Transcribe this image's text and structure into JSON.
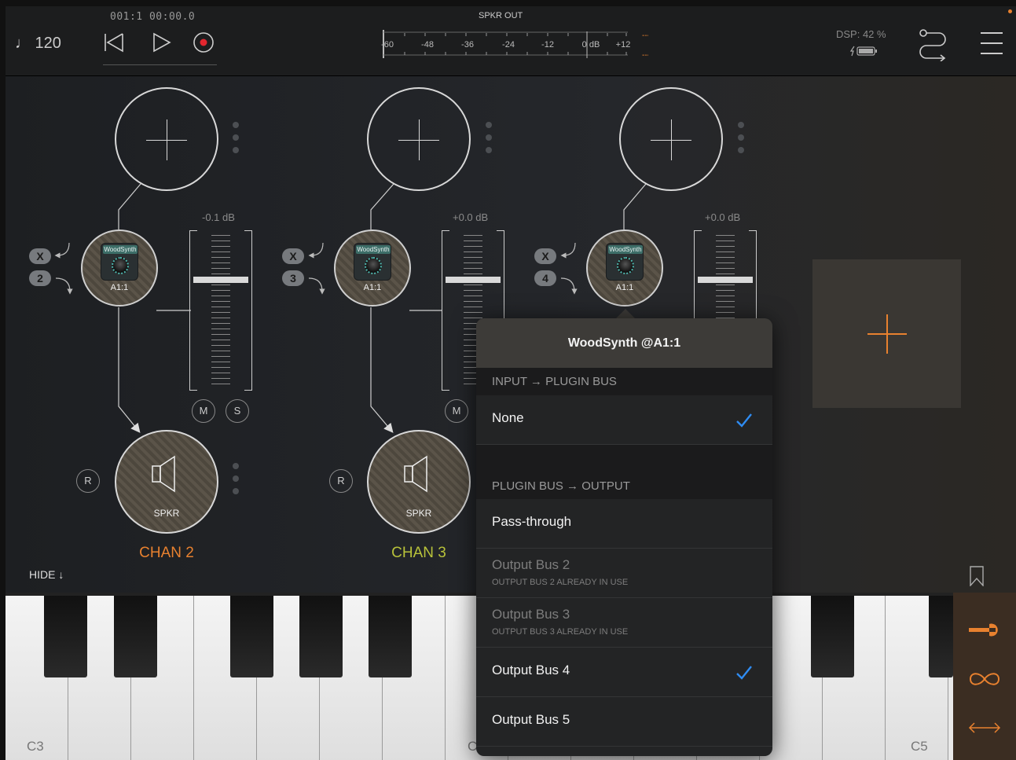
{
  "transport": {
    "tempo": "♩ 120",
    "position": "001:1  00:00.0"
  },
  "meter": {
    "title": "SPKR OUT",
    "scale": [
      "-60",
      "-48",
      "-36",
      "-24",
      "-12",
      "0 dB",
      "+12"
    ],
    "peak_top": "---",
    "peak_bottom": "---"
  },
  "status": {
    "dsp": "DSP: 42 %"
  },
  "channels": [
    {
      "label": "CHAN 2",
      "color": "#e8812f",
      "bus_in": "X",
      "bus_out": "2",
      "plugin_name": "WoodSynth",
      "plugin_slot": "A1:1",
      "gain": "-0.1 dB",
      "gain_position": 0.31,
      "speaker": "SPKR",
      "mute": "M",
      "solo": "S",
      "record": "R"
    },
    {
      "label": "CHAN 3",
      "color": "#b8c23a",
      "bus_in": "X",
      "bus_out": "3",
      "plugin_name": "WoodSynth",
      "plugin_slot": "A1:1",
      "gain": "+0.0 dB",
      "gain_position": 0.31,
      "speaker": "SPKR",
      "mute": "M",
      "record": "R"
    },
    {
      "bus_in": "X",
      "bus_out": "4",
      "plugin_name": "WoodSynth",
      "plugin_slot": "A1:1",
      "gain": "+0.0 dB",
      "gain_position": 0.31
    }
  ],
  "hide_button": "HIDE ↓",
  "keyboard": {
    "labels": [
      "C3",
      "C",
      "C5"
    ]
  },
  "popover": {
    "title": "WoodSynth @A1:1",
    "section_input": "INPUT → PLUGIN BUS",
    "input_none": "None",
    "section_output": "PLUGIN BUS → OUTPUT",
    "passthrough": "Pass-through",
    "bus2": "Output Bus 2",
    "bus2_note": "OUTPUT BUS 2 ALREADY IN USE",
    "bus3": "Output Bus 3",
    "bus3_note": "OUTPUT BUS 3 ALREADY IN USE",
    "bus4": "Output Bus 4",
    "bus5": "Output Bus 5",
    "check_color": "#2f8cf2"
  },
  "icons": [
    "tempo-note",
    "rewind-icon",
    "play-icon",
    "record-icon",
    "battery-icon",
    "routing-icon",
    "menu-icon",
    "speaker-icon",
    "bookmark-icon",
    "wrench-icon",
    "loop-icon",
    "arrows-icon",
    "checkmark-icon",
    "plus-icon"
  ]
}
